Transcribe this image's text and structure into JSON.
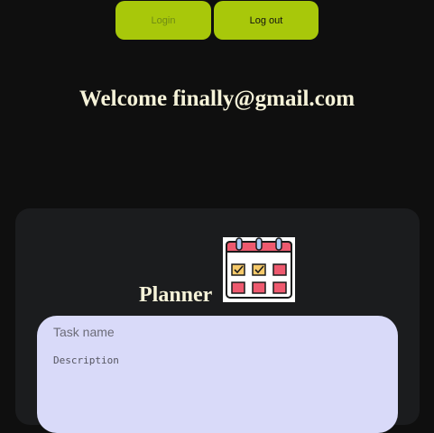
{
  "auth": {
    "login_label": "Login",
    "logout_label": "Log out"
  },
  "welcome": {
    "text": "Welcome finally@gmail.com"
  },
  "planner": {
    "title": "Planner",
    "icon": "calendar-checklist-icon",
    "task_name_placeholder": "Task name",
    "description_placeholder": "Description"
  },
  "colors": {
    "background": "#0f0f0f",
    "card": "#1b1c1e",
    "accent": "#a8c80a",
    "heading_text": "#f6f3d9",
    "form_background": "#d9daf9",
    "calendar_red": "#ee5a6f",
    "calendar_check": "#f5c96a"
  }
}
